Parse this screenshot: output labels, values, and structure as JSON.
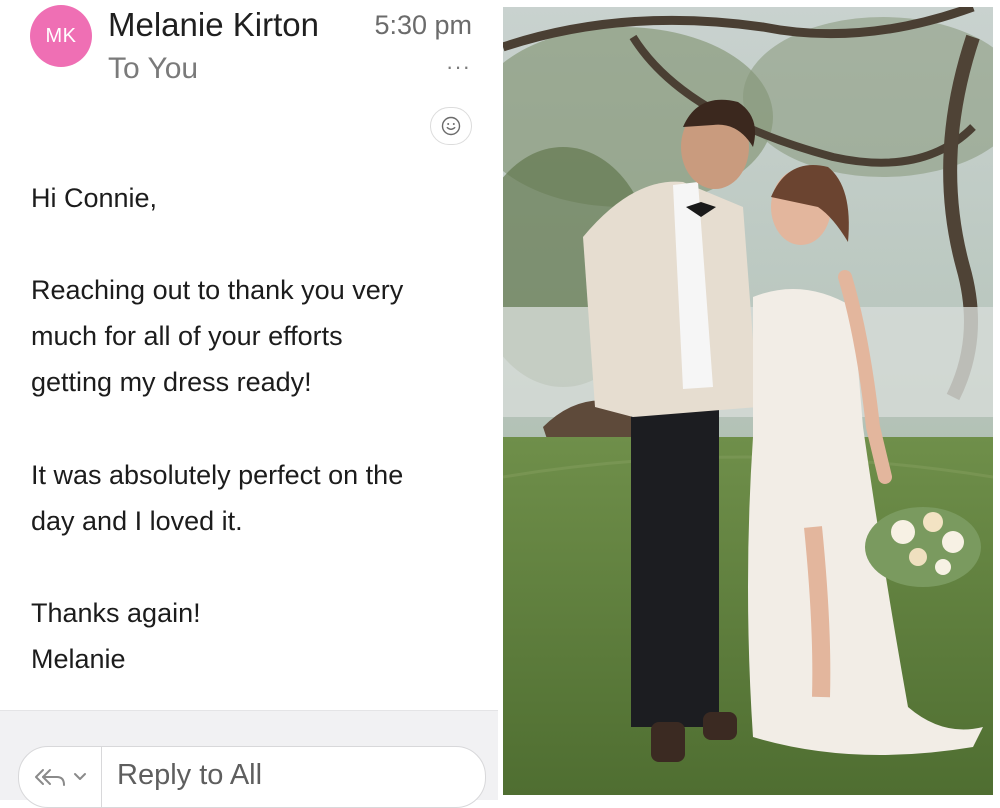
{
  "sender": {
    "initials": "MK",
    "name": "Melanie Kirton",
    "time": "5:30 pm",
    "to": "To You",
    "avatar_color": "#ef6fb4"
  },
  "actions": {
    "more": "···"
  },
  "message": {
    "greeting": "Hi Connie,",
    "para1": [
      "Reaching out to thank you very",
      "much for all of your efforts",
      "getting my dress ready!"
    ],
    "para2": [
      "It was absolutely perfect on the",
      "day and I loved it."
    ],
    "closing": "Thanks again!",
    "signature": "Melanie"
  },
  "reply": {
    "label": "Reply to All"
  }
}
